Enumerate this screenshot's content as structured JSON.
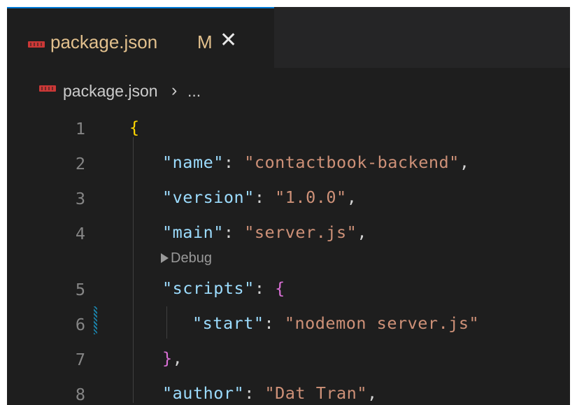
{
  "tab": {
    "label": "package.json",
    "modified_flag": "M",
    "close_glyph": "✕",
    "icon": "npm-icon",
    "active_border_color": "#0078d4"
  },
  "breadcrumb": {
    "file": "package.json",
    "separator": "›",
    "ellipsis": "..."
  },
  "codelens": {
    "label": "Debug"
  },
  "lines": [
    {
      "num": "1",
      "tokens": [
        {
          "t": "{",
          "k": "br1"
        }
      ]
    },
    {
      "num": "2",
      "tokens": [
        {
          "t": "\"name\"",
          "k": "key"
        },
        {
          "t": ": ",
          "k": "pun"
        },
        {
          "t": "\"contactbook-backend\"",
          "k": "str"
        },
        {
          "t": ",",
          "k": "pun"
        }
      ]
    },
    {
      "num": "3",
      "tokens": [
        {
          "t": "\"version\"",
          "k": "key"
        },
        {
          "t": ": ",
          "k": "pun"
        },
        {
          "t": "\"1.0.0\"",
          "k": "str"
        },
        {
          "t": ",",
          "k": "pun"
        }
      ]
    },
    {
      "num": "4",
      "tokens": [
        {
          "t": "\"main\"",
          "k": "key"
        },
        {
          "t": ": ",
          "k": "pun"
        },
        {
          "t": "\"server.js\"",
          "k": "str"
        },
        {
          "t": ",",
          "k": "pun"
        }
      ]
    },
    {
      "num": "5",
      "tokens": [
        {
          "t": "\"scripts\"",
          "k": "key"
        },
        {
          "t": ": ",
          "k": "pun"
        },
        {
          "t": "{",
          "k": "br2"
        }
      ]
    },
    {
      "num": "6",
      "tokens": [
        {
          "t": "\"start\"",
          "k": "key"
        },
        {
          "t": ": ",
          "k": "pun"
        },
        {
          "t": "\"nodemon server.js\"",
          "k": "str"
        }
      ]
    },
    {
      "num": "7",
      "tokens": [
        {
          "t": "}",
          "k": "br2"
        },
        {
          "t": ",",
          "k": "pun"
        }
      ]
    },
    {
      "num": "8",
      "tokens": [
        {
          "t": "\"author\"",
          "k": "key"
        },
        {
          "t": ": ",
          "k": "pun"
        },
        {
          "t": "\"Dat Tran\"",
          "k": "str"
        },
        {
          "t": ",",
          "k": "pun"
        }
      ]
    }
  ]
}
